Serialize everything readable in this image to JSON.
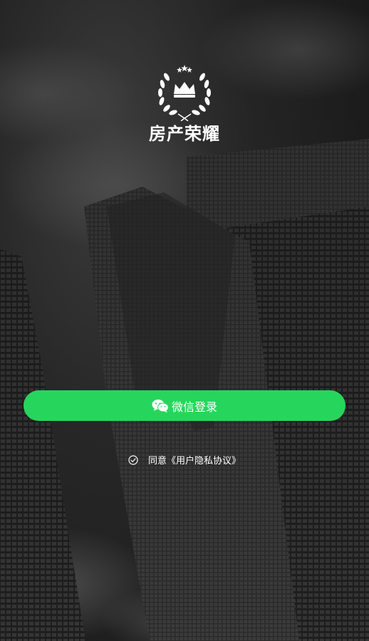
{
  "app": {
    "name": "房产荣耀"
  },
  "login": {
    "wechat_button_label": "微信登录",
    "wechat_icon": "wechat-icon"
  },
  "agreement": {
    "text": "同意《用户隐私协议》",
    "checkbox_icon": "check-circle-icon"
  },
  "colors": {
    "accent": "#26d65c",
    "background": "#1a1a1a",
    "text": "#ffffff"
  }
}
